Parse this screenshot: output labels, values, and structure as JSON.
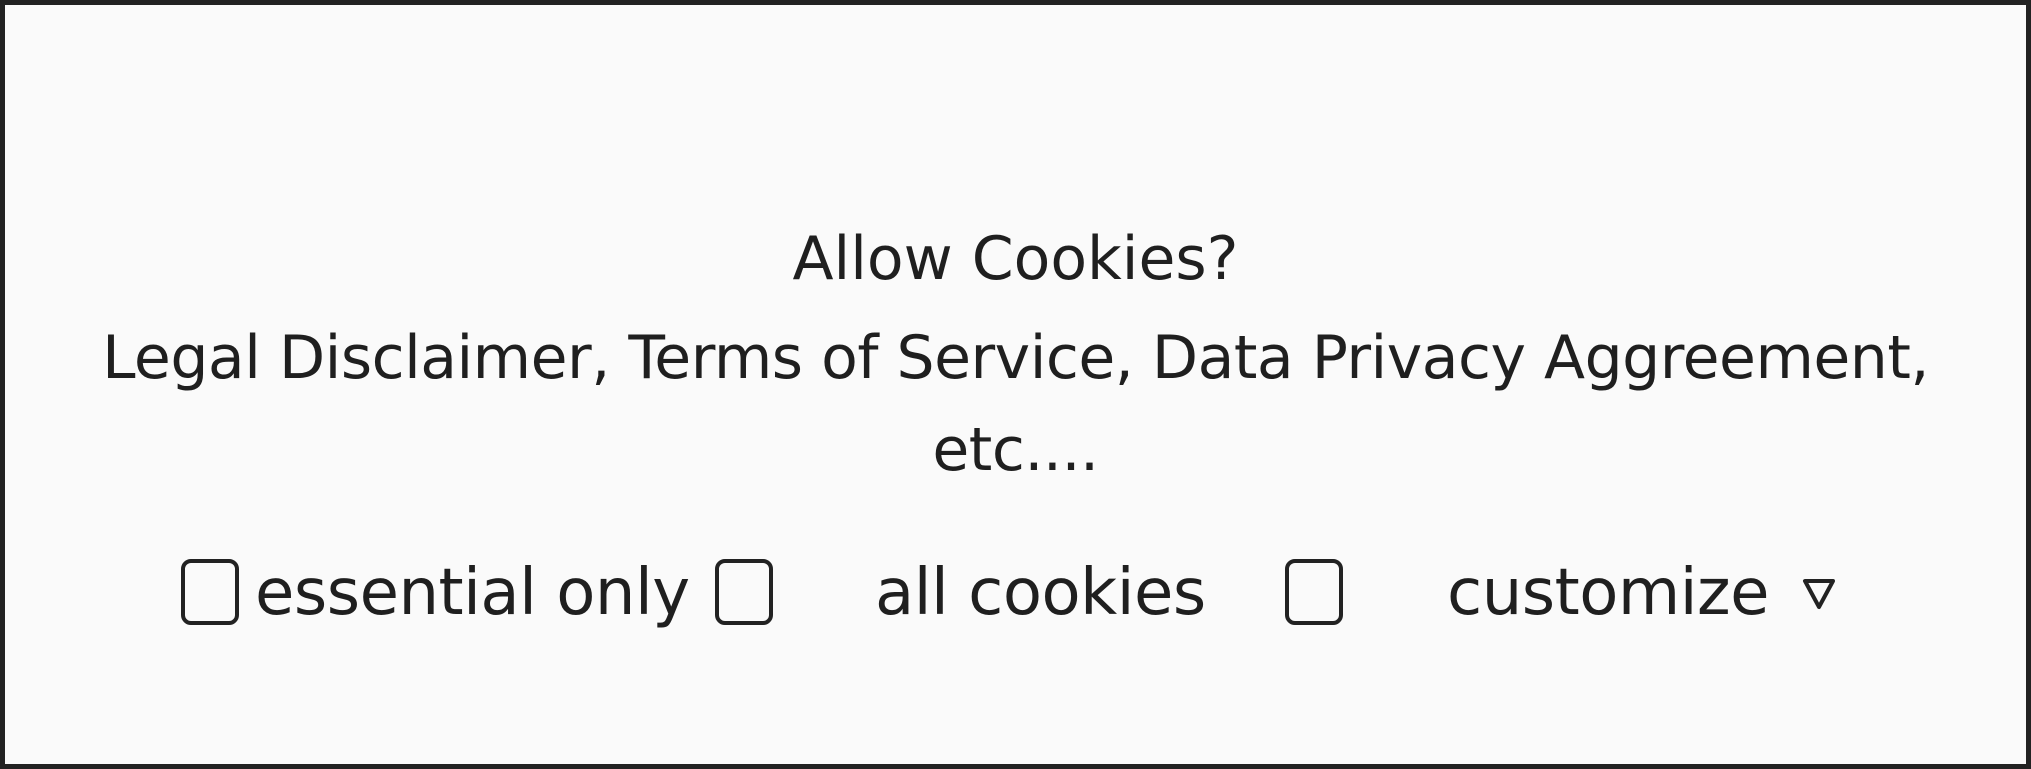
{
  "dialog": {
    "title": "Allow Cookies?",
    "body": "Legal Disclaimer, Terms of Service, Data Privacy Aggreement, etc...."
  },
  "options": {
    "essential_label": "essential only",
    "all_label": "all cookies",
    "customize_label": "customize",
    "customize_icon": "triangle-down-outline-icon"
  },
  "colors": {
    "background": "#fafafa",
    "border": "#222222",
    "text": "#1f1f1f"
  }
}
